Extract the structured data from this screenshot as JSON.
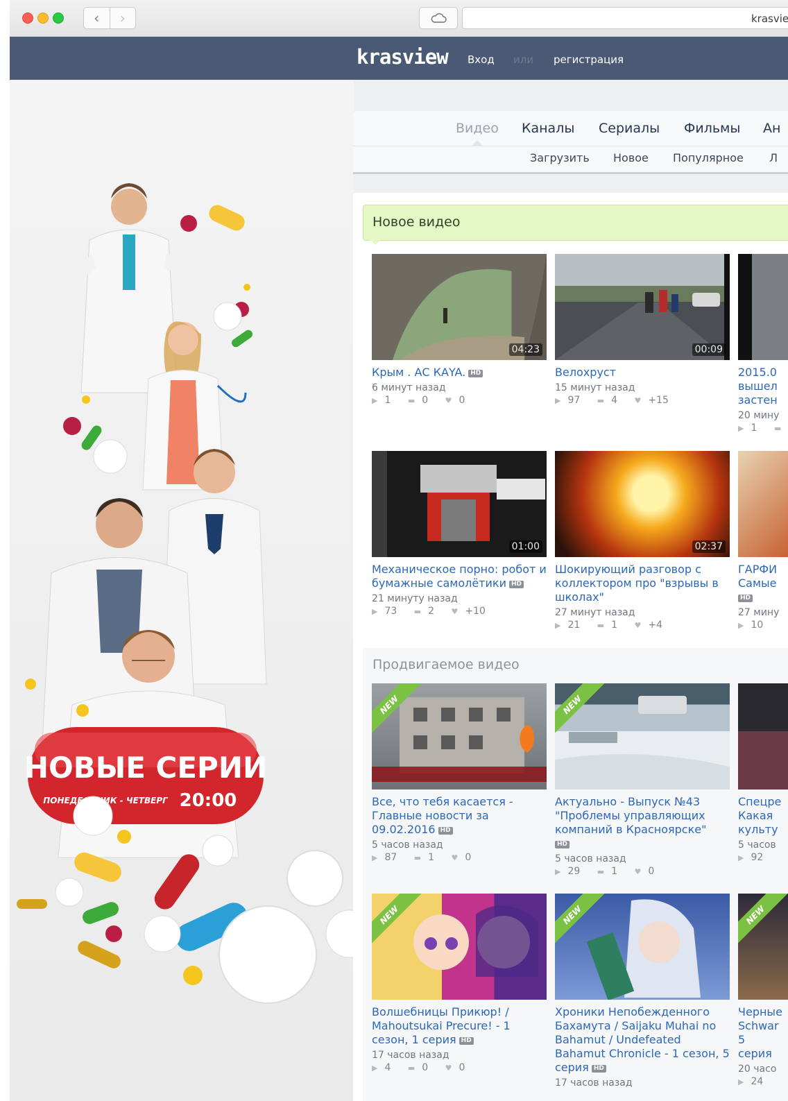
{
  "browser": {
    "url": "krasview.ru"
  },
  "header": {
    "logo": "krasview",
    "login": "Вход",
    "or": "или",
    "register": "регистрация"
  },
  "nav": {
    "tabs": [
      "Видео",
      "Каналы",
      "Сериалы",
      "Фильмы",
      "Ан"
    ],
    "subtabs": [
      "Загрузить",
      "Новое",
      "Популярное",
      "Л"
    ]
  },
  "promo": {
    "title": "НОВЫЕ СЕРИИ",
    "days": "ПОНЕДЕЛЬНИК - ЧЕТВЕРГ",
    "time": "20:00"
  },
  "sections": {
    "new_title": "Новое видео",
    "promoted_title": "Продвигаемое видео"
  },
  "new_videos": [
    {
      "title": "Крым . АС КАYA.",
      "hd": "HD",
      "duration": "04:23",
      "time": "6 минут назад",
      "views": "1",
      "comments": "0",
      "likes": "0"
    },
    {
      "title": "Велохруст",
      "hd": "",
      "duration": "00:09",
      "time": "15 минут назад",
      "views": "97",
      "comments": "4",
      "likes": "+15"
    },
    {
      "title": "2015.0 вышел застен",
      "hd": "",
      "duration": "",
      "time": "20 мину",
      "views": "1",
      "comments": "0",
      "likes": ""
    },
    {
      "title": "Механическое порно: робот и бумажные самолётики",
      "hd": "HD",
      "duration": "01:00",
      "time": "21 минуту назад",
      "views": "73",
      "comments": "2",
      "likes": "+10"
    },
    {
      "title": "Шокирующий разговор с коллектором про \"взрывы в школах\"",
      "hd": "",
      "duration": "02:37",
      "time": "27 минут назад",
      "views": "21",
      "comments": "1",
      "likes": "+4"
    },
    {
      "title": "ГАРФИ Самые",
      "hd": "HD",
      "duration": "",
      "time": "27 мину",
      "views": "10",
      "comments": "",
      "likes": ""
    }
  ],
  "promoted_videos": [
    {
      "title": "Все, что тебя касается - Главные новости за 09.02.2016",
      "hd": "HD",
      "badge": "NEW",
      "time": "5 часов назад",
      "views": "87",
      "comments": "1",
      "likes": "0"
    },
    {
      "title": "Актуально - Выпуск №43 \"Проблемы управляющих компаний в Красноярске\"",
      "hd": "HD",
      "badge": "NEW",
      "time": "5 часов назад",
      "views": "29",
      "comments": "1",
      "likes": "0"
    },
    {
      "title": "Спецре Какая культу",
      "hd": "",
      "badge": "",
      "time": "5 часов",
      "views": "92",
      "comments": "",
      "likes": ""
    },
    {
      "title": "Волшебницы Прикюр! / Mahoutsukai Precure! - 1 сезон, 1 серия",
      "hd": "HD",
      "badge": "NEW",
      "time": "17 часов назад",
      "views": "4",
      "comments": "0",
      "likes": "0"
    },
    {
      "title": "Хроники Непобежденного Бахамута / Saijaku Muhai no Bahamut / Undefeated Bahamut Chronicle - 1 сезон, 5 серия",
      "hd": "HD",
      "badge": "NEW",
      "time": "17 часов назад",
      "views": "",
      "comments": "",
      "likes": ""
    },
    {
      "title": "Черные Schwar 5 серия",
      "hd": "",
      "badge": "NEW",
      "time": "20 часо",
      "views": "24",
      "comments": "",
      "likes": ""
    }
  ]
}
